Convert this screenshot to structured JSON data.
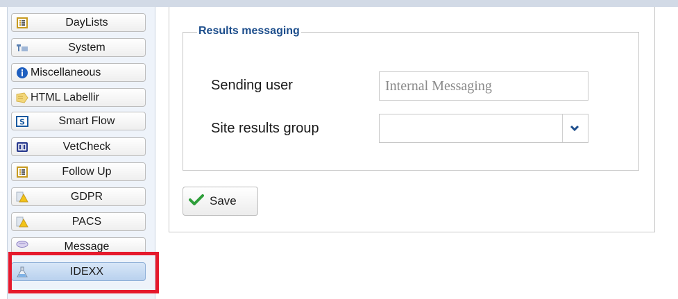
{
  "sidebar": {
    "items": [
      {
        "label": "DayLists",
        "icon": "list-icon"
      },
      {
        "label": "System",
        "icon": "system-icon"
      },
      {
        "label": "Miscellaneous",
        "icon": "info-icon"
      },
      {
        "label": "HTML Labellir",
        "icon": "label-icon"
      },
      {
        "label": "Smart Flow",
        "icon": "smartflow-icon"
      },
      {
        "label": "VetCheck",
        "icon": "vetcheck-icon"
      },
      {
        "label": "Follow Up",
        "icon": "list-icon"
      },
      {
        "label": "GDPR",
        "icon": "warning-doc-icon"
      },
      {
        "label": "PACS",
        "icon": "warning-doc-icon"
      },
      {
        "label": "Message",
        "icon": "message-icon"
      },
      {
        "label": "IDEXX",
        "icon": "flask-icon",
        "active": true
      }
    ]
  },
  "form": {
    "legend": "Results messaging",
    "sending_user_label": "Sending user",
    "sending_user_placeholder": "Internal Messaging",
    "site_results_group_label": "Site results group",
    "site_results_group_value": ""
  },
  "save_label": "Save",
  "colors": {
    "accent": "#1d4e8c",
    "highlight": "#e5192c",
    "check": "#2e9e3a"
  }
}
